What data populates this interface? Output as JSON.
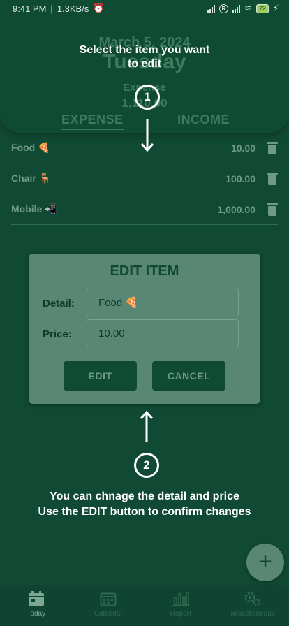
{
  "status_bar": {
    "time": "9:41 PM",
    "speed": "1.3KB/s",
    "battery": "72"
  },
  "header": {
    "date": "March 5, 2024",
    "day": "Tuesday",
    "expense_label": "Expense",
    "expense_total": "1,110.00"
  },
  "tabs": [
    {
      "label": "EXPENSE"
    },
    {
      "label": "INCOME"
    }
  ],
  "items": [
    {
      "detail": "Food 🍕",
      "price": "10.00"
    },
    {
      "detail": "Chair 🪑",
      "price": "100.00"
    },
    {
      "detail": "Mobile 📲",
      "price": "1,000.00"
    }
  ],
  "dialog": {
    "title": "EDIT ITEM",
    "detail_label": "Detail:",
    "detail_value": "Food 🍕",
    "price_label": "Price:",
    "price_value": "10.00",
    "edit_label": "EDIT",
    "cancel_label": "CANCEL"
  },
  "overlay": {
    "step1_number": "1",
    "step1_line1": "Select the item you want",
    "step1_line2": "to edit",
    "step2_number": "2",
    "step2_line1": "You can chnage the detail and price",
    "step2_line2": "Use the EDIT button to confirm changes"
  },
  "fab_label": "+",
  "nav": [
    {
      "label": "Today",
      "icon": "calendar-day-icon"
    },
    {
      "label": "Calendar",
      "icon": "calendar-grid-icon"
    },
    {
      "label": "Report",
      "icon": "bar-chart-icon"
    },
    {
      "label": "Miscellaneous",
      "icon": "gears-icon"
    }
  ]
}
